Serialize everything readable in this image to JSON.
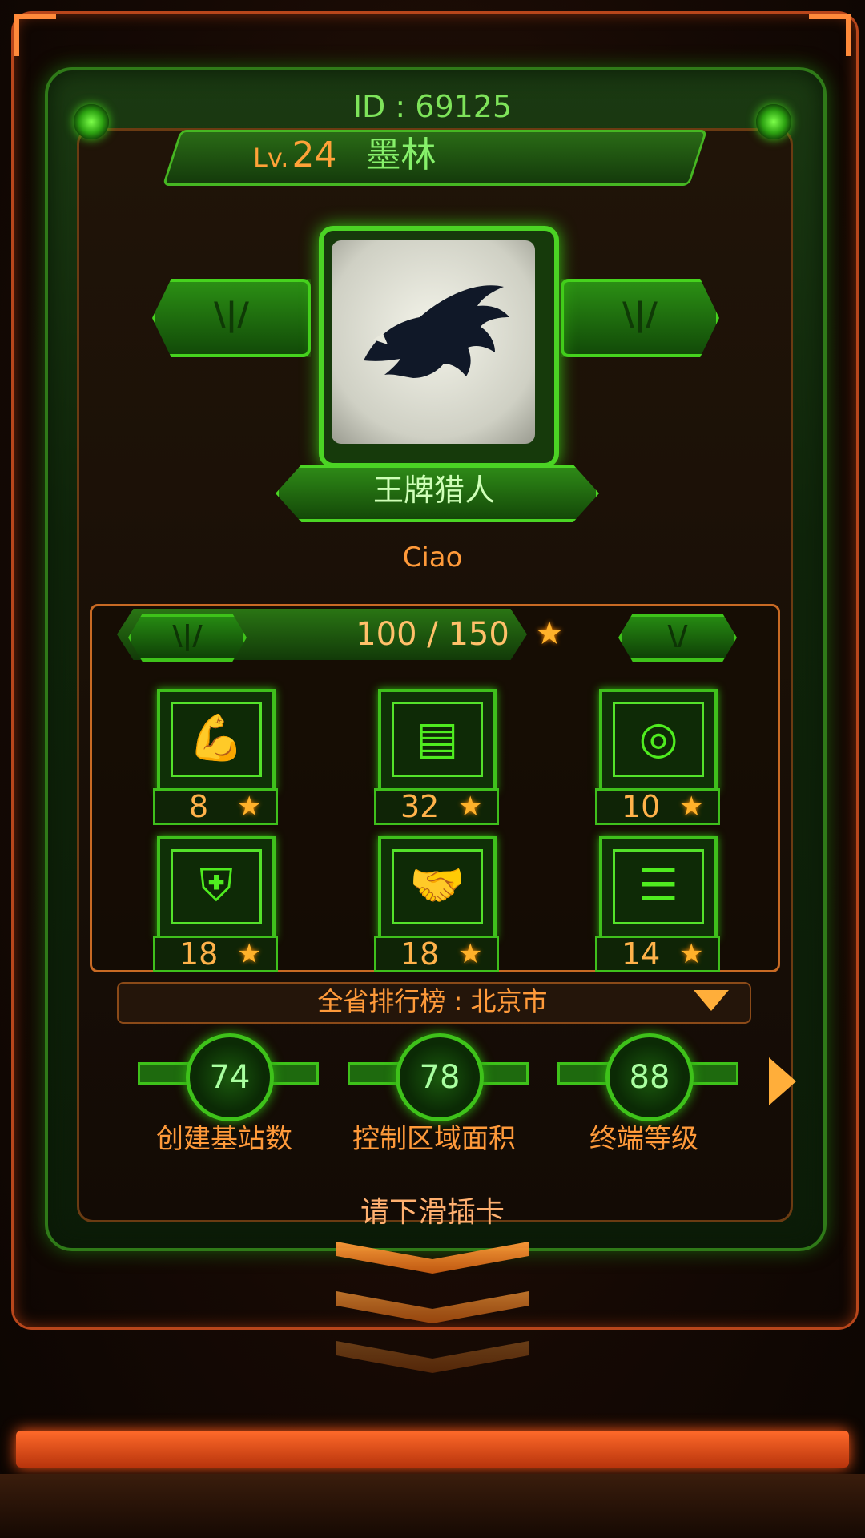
{
  "profile": {
    "id_text": "ID : 69125",
    "level_label": "Lv.",
    "level": "24",
    "name": "墨林",
    "title": "王牌猎人",
    "nickname": "Ciao"
  },
  "progress": {
    "text": "100 / 150",
    "value": 100,
    "max": 150,
    "star_icon": "star-icon",
    "left_button_glyph": "\\|/",
    "right_button_glyph": "\\/"
  },
  "attributes": [
    {
      "icon": "muscle-icon",
      "glyph": "💪",
      "value": "8"
    },
    {
      "icon": "chip-icon",
      "glyph": "▤",
      "value": "32"
    },
    {
      "icon": "target-icon",
      "glyph": "◎",
      "value": "10"
    },
    {
      "icon": "shield-icon",
      "glyph": "⛨",
      "value": "18"
    },
    {
      "icon": "handshake-icon",
      "glyph": "🤝",
      "value": "18"
    },
    {
      "icon": "tree-icon",
      "glyph": "☰",
      "value": "14"
    }
  ],
  "ranking": {
    "label": "全省排行榜 : 北京市"
  },
  "gauges": [
    {
      "value": "74",
      "label": "创建基站数"
    },
    {
      "value": "78",
      "label": "控制区域面积"
    },
    {
      "value": "88",
      "label": "终端等级"
    }
  ],
  "hint": "请下滑插卡",
  "colors": {
    "accent_green": "#4bd424",
    "accent_orange": "#ff9a3a",
    "star": "#ffb12a"
  }
}
